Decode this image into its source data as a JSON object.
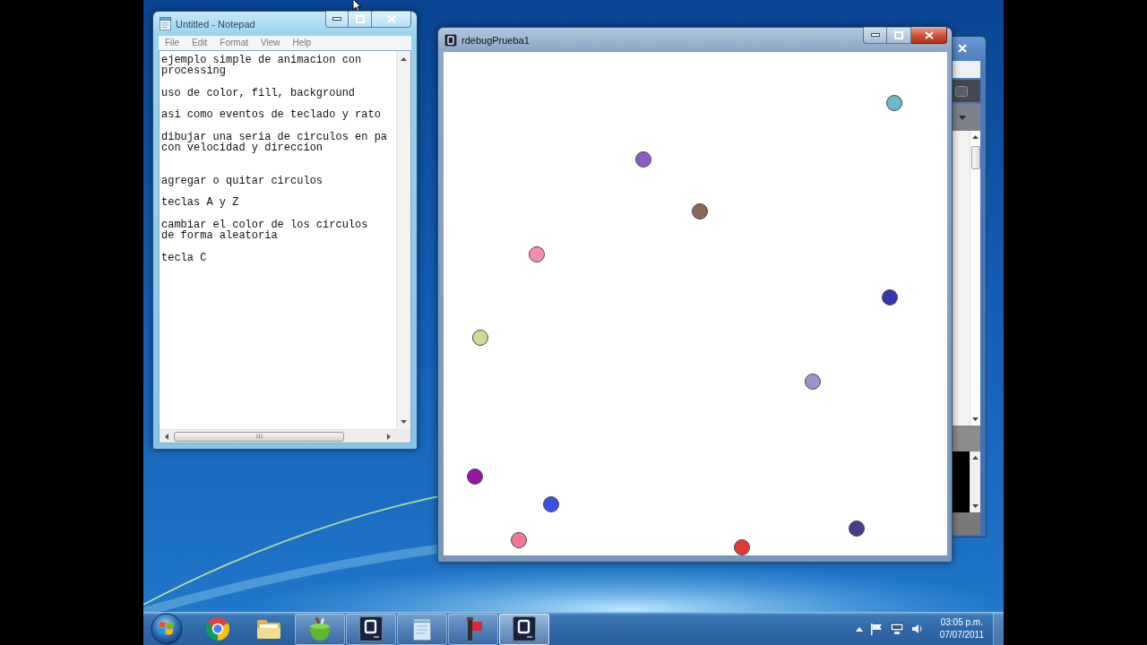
{
  "notepad": {
    "title": "Untitled - Notepad",
    "active": false,
    "menu": [
      "File",
      "Edit",
      "Format",
      "View",
      "Help"
    ],
    "text": "ejemplo simple de animacion con\nprocessing\n\nuso de color, fill, background\n\nasi como eventos de teclado y rato\n\ndibujar una seria de circulos en pa\ncon velocidad y direccion\n\n\nagregar o quitar circulos\n\nteclas A y Z\n\ncambiar el color de los circulos\nde forma aleatoria\n\ntecla C"
  },
  "sketch": {
    "title": "rdebugPrueba1",
    "active": true,
    "circles": [
      {
        "color": "#6cb8cc"
      },
      {
        "color": "#8a5ccc"
      },
      {
        "color": "#8c6656"
      },
      {
        "color": "#f28cb0"
      },
      {
        "color": "#3434b4"
      },
      {
        "color": "#c9dd94"
      },
      {
        "color": "#9894cc"
      },
      {
        "color": "#9a14a6"
      },
      {
        "color": "#3a50e8"
      },
      {
        "color": "#f2789a"
      },
      {
        "color": "#463c90"
      },
      {
        "color": "#e23a32"
      }
    ]
  },
  "taskbar": {
    "items": [
      {
        "kind": "browser",
        "running": false,
        "selected": false
      },
      {
        "kind": "folder",
        "running": false,
        "selected": false
      },
      {
        "kind": "bag",
        "running": true,
        "selected": false
      },
      {
        "kind": "tile",
        "running": true,
        "selected": false
      },
      {
        "kind": "notepad",
        "running": true,
        "selected": false
      },
      {
        "kind": "flag",
        "running": true,
        "selected": false
      },
      {
        "kind": "tile",
        "running": true,
        "selected": true
      }
    ]
  },
  "clock": {
    "time": "03:05 p.m.",
    "date": "07/07/2011"
  }
}
